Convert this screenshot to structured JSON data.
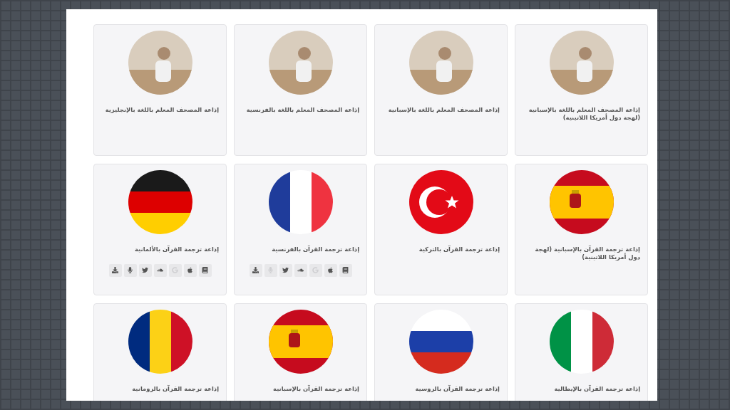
{
  "cards": [
    {
      "kind": "photo",
      "title": "إذاعة المصحف المعلم باللغة بالإسبانية (لهجة دول أمريكا اللاتينية)"
    },
    {
      "kind": "photo",
      "title": "إذاعة المصحف المعلم باللغة بالإسبانية"
    },
    {
      "kind": "photo",
      "title": "إذاعة المصحف المعلم باللغة بالفرنسية"
    },
    {
      "kind": "photo",
      "title": "إذاعة المصحف المعلم باللغة بالإنجليزية"
    },
    {
      "kind": "flag_es",
      "title": "إذاعة ترجمة القرآن بالإسبانية (لهجة دول أمريكا اللاتينية)"
    },
    {
      "kind": "flag_tr",
      "title": "إذاعة ترجمة القرآن بالتركية"
    },
    {
      "kind": "flag_fr",
      "title": "إذاعة ترجمة القرآن بالفرنسية",
      "links": [
        {
          "kind": "book",
          "disabled": false
        },
        {
          "kind": "apple",
          "disabled": false
        },
        {
          "kind": "google",
          "disabled": true
        },
        {
          "kind": "soundcloud",
          "disabled": false
        },
        {
          "kind": "twitter",
          "disabled": false
        },
        {
          "kind": "mic",
          "disabled": true
        },
        {
          "kind": "download",
          "disabled": false
        }
      ]
    },
    {
      "kind": "flag_de",
      "title": "إذاعة ترجمة القرآن بالألمانية",
      "links": [
        {
          "kind": "book",
          "disabled": false
        },
        {
          "kind": "apple",
          "disabled": false
        },
        {
          "kind": "google",
          "disabled": true
        },
        {
          "kind": "soundcloud",
          "disabled": false
        },
        {
          "kind": "twitter",
          "disabled": false
        },
        {
          "kind": "mic",
          "disabled": false
        },
        {
          "kind": "download",
          "disabled": false
        }
      ]
    },
    {
      "kind": "flag_it",
      "title": "إذاعة ترجمة القرآن بالإيطالية"
    },
    {
      "kind": "flag_ru",
      "title": "إذاعة ترجمة القرآن بالروسية"
    },
    {
      "kind": "flag_es",
      "title": "إذاعة ترجمة القرآن بالإسبانية"
    },
    {
      "kind": "flag_ro",
      "title": "إذاعة ترجمة القرآن بالرومانية"
    }
  ]
}
